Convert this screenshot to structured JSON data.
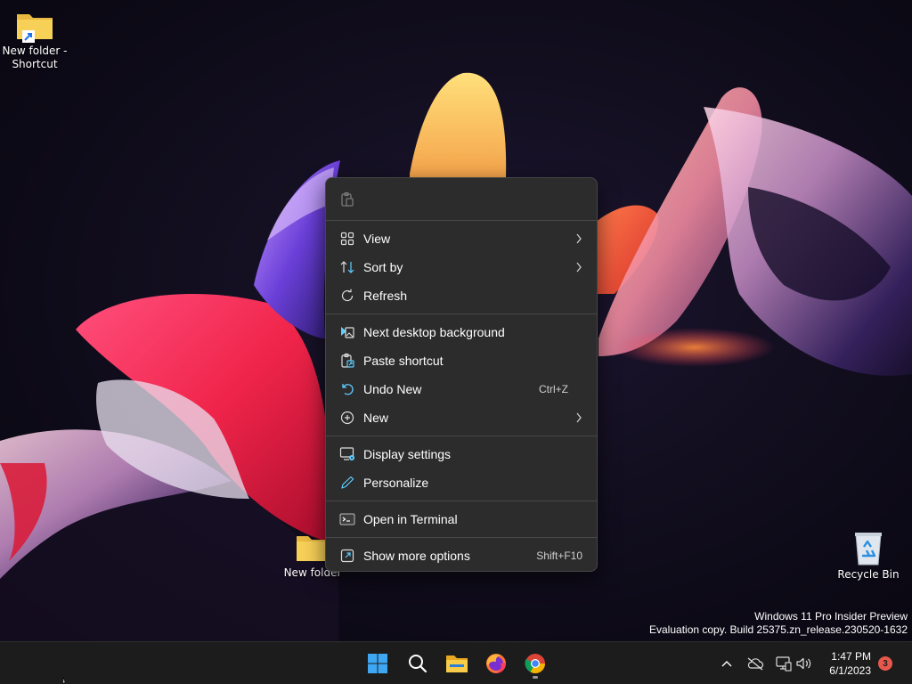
{
  "desktop": {
    "icons": [
      {
        "label": "New folder - Shortcut",
        "icon": "folder-shortcut-icon"
      },
      {
        "label": "New folder",
        "icon": "folder-icon"
      },
      {
        "label": "Recycle Bin",
        "icon": "recycle-bin-icon"
      }
    ],
    "watermark": {
      "line1": "Windows 11 Pro Insider Preview",
      "line2": "Evaluation copy. Build 25375.zn_release.230520-1632"
    }
  },
  "context_menu": {
    "quick_actions": [
      {
        "icon": "paste-icon"
      }
    ],
    "groups": [
      [
        {
          "label": "View",
          "icon": "view-grid-icon",
          "submenu": true
        },
        {
          "label": "Sort by",
          "icon": "sort-icon",
          "submenu": true
        },
        {
          "label": "Refresh",
          "icon": "refresh-icon"
        }
      ],
      [
        {
          "label": "Next desktop background",
          "icon": "next-background-icon"
        },
        {
          "label": "Paste shortcut",
          "icon": "paste-shortcut-icon"
        },
        {
          "label": "Undo New",
          "icon": "undo-icon",
          "shortcut": "Ctrl+Z"
        },
        {
          "label": "New",
          "icon": "new-plus-icon",
          "submenu": true
        }
      ],
      [
        {
          "label": "Display settings",
          "icon": "display-settings-icon"
        },
        {
          "label": "Personalize",
          "icon": "pen-icon"
        }
      ],
      [
        {
          "label": "Open in Terminal",
          "icon": "terminal-icon"
        }
      ],
      [
        {
          "label": "Show more options",
          "icon": "more-options-icon",
          "shortcut": "Shift+F10"
        }
      ]
    ]
  },
  "taskbar": {
    "apps": [
      {
        "name": "start",
        "icon": "windows-start-icon"
      },
      {
        "name": "search",
        "icon": "search-icon"
      },
      {
        "name": "file-explorer",
        "icon": "file-explorer-icon"
      },
      {
        "name": "firefox",
        "icon": "firefox-icon"
      },
      {
        "name": "chrome",
        "icon": "chrome-icon",
        "running": true
      }
    ],
    "tray": {
      "icons": [
        "chevron-up-icon",
        "cloud-offline-icon",
        "network-icon",
        "volume-icon"
      ],
      "time": "1:47 PM",
      "date": "6/1/2023",
      "notification_count": "3"
    }
  },
  "colors": {
    "menu_bg": "#2c2c2c",
    "menu_border": "#464646",
    "accent": "#60cdff",
    "taskbar_bg": "#1c1c1c",
    "badge": "#e7584c"
  }
}
